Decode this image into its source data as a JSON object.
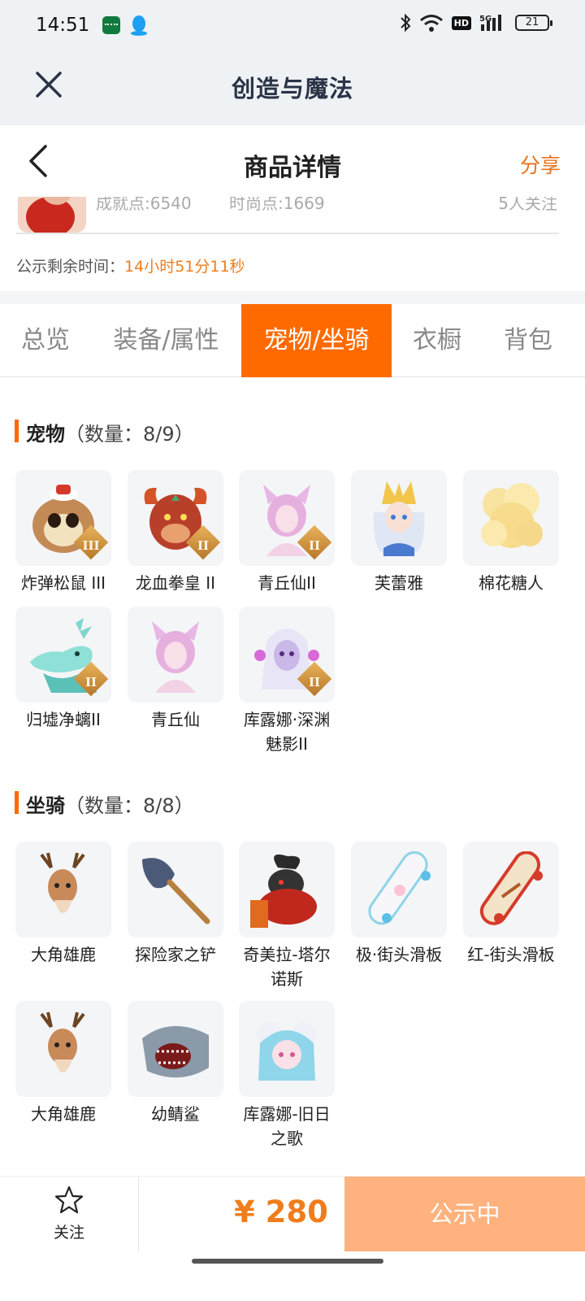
{
  "status_bar": {
    "time": "14:51",
    "battery": "21"
  },
  "app_header": {
    "title": "创造与魔法"
  },
  "nav": {
    "title": "商品详情",
    "share": "分享"
  },
  "seller": {
    "stat1": "成就点:6540",
    "stat2": "时尚点:1669",
    "followers": "5人关注"
  },
  "publicity": {
    "label": "公示剩余时间：",
    "remaining": "14小时51分11秒"
  },
  "tabs": [
    {
      "label": "总览"
    },
    {
      "label": "装备/属性"
    },
    {
      "label": "宠物/坐骑"
    },
    {
      "label": "衣橱"
    },
    {
      "label": "背包"
    }
  ],
  "active_tab": "宠物/坐骑",
  "pets": {
    "title": "宠物",
    "count": "（数量：8/9）",
    "items": [
      {
        "name": "炸弹松鼠 III",
        "grade": "III"
      },
      {
        "name": "龙血拳皇 II",
        "grade": "II"
      },
      {
        "name": "青丘仙II",
        "grade": "II"
      },
      {
        "name": "芙蕾雅",
        "grade": ""
      },
      {
        "name": "棉花糖人",
        "grade": ""
      },
      {
        "name": "归墟净螭II",
        "grade": "II"
      },
      {
        "name": "青丘仙",
        "grade": ""
      },
      {
        "name": "库露娜·深渊魅影II",
        "grade": "II"
      }
    ]
  },
  "mounts": {
    "title": "坐骑",
    "count": "（数量：8/8）",
    "items": [
      {
        "name": "大角雄鹿"
      },
      {
        "name": "探险家之铲"
      },
      {
        "name": "奇美拉-塔尔诺斯"
      },
      {
        "name": "极·街头滑板"
      },
      {
        "name": "红-街头滑板"
      },
      {
        "name": "大角雄鹿"
      },
      {
        "name": "幼鲭鲨"
      },
      {
        "name": "库露娜-旧日之歌"
      }
    ]
  },
  "bottom": {
    "follow": "关注",
    "price": "¥ 280",
    "status_button": "公示中"
  },
  "colors": {
    "accent": "#ff6a00",
    "price": "#f07d1b",
    "button_disabled": "#ffb27d"
  }
}
